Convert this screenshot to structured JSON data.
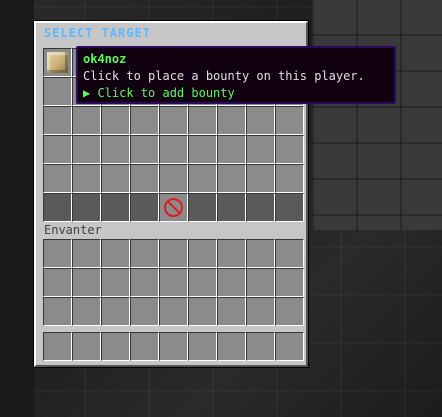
{
  "window": {
    "title": "SELECT TARGET",
    "inventory_label": "Envanter"
  },
  "slots": {
    "head_player": "ok4noz",
    "barrier_icon": "barrier-icon"
  },
  "tooltip": {
    "name": "ok4noz",
    "description": "Click to place a bounty on this player.",
    "action": "▶ Click to add bounty"
  },
  "colors": {
    "title": "#5fb8ff",
    "tooltip_name": "#55ff55",
    "barrier": "#e01b1b",
    "panel": "#c6c6c6",
    "slot": "#8b8b8b"
  }
}
